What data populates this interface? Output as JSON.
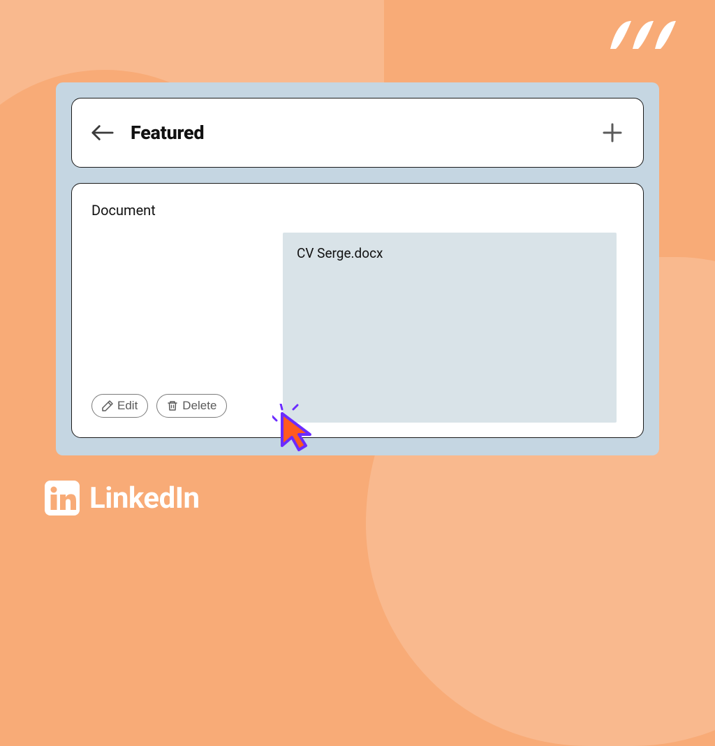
{
  "header": {
    "title": "Featured"
  },
  "content": {
    "type_label": "Document",
    "filename": "CV Serge.docx"
  },
  "actions": {
    "edit_label": "Edit",
    "delete_label": "Delete"
  },
  "brand": {
    "name": "LinkedIn"
  }
}
